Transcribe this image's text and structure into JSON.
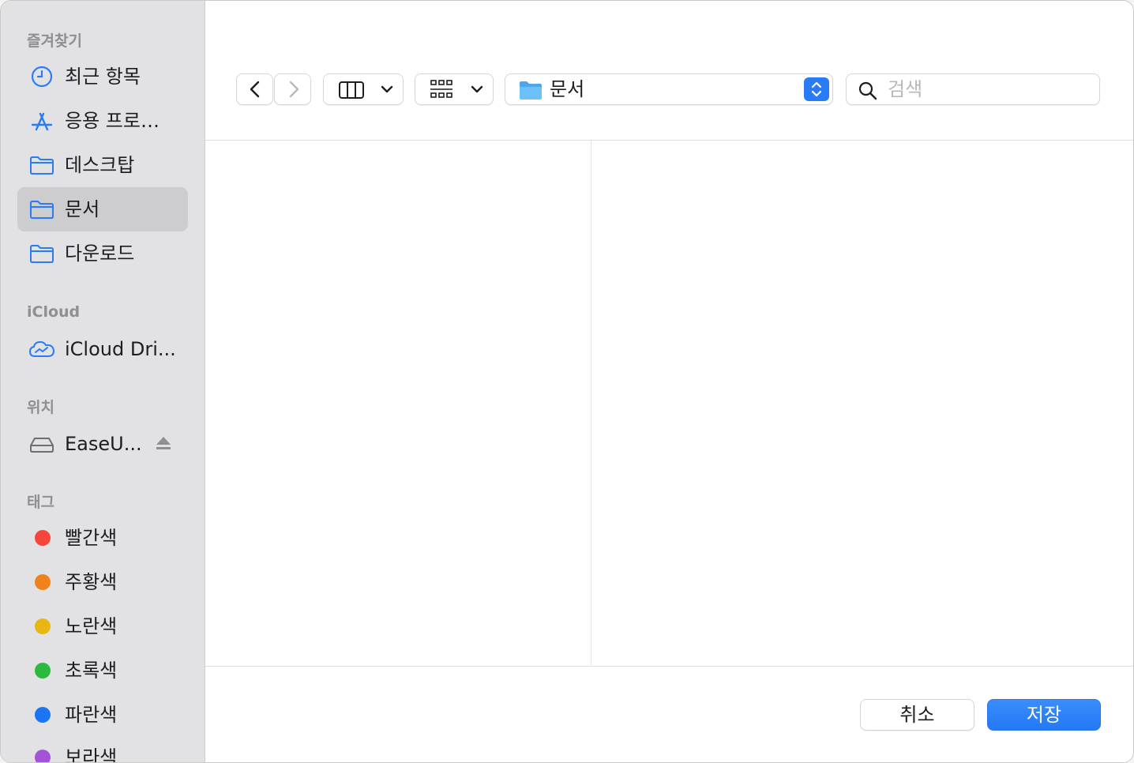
{
  "sidebar": {
    "favorites_header": "즐겨찾기",
    "favorites": [
      {
        "label": "최근 항목",
        "icon": "clock-icon"
      },
      {
        "label": "응용 프로…",
        "icon": "applications-icon"
      },
      {
        "label": "데스크탑",
        "icon": "folder-icon"
      },
      {
        "label": "문서",
        "icon": "folder-icon",
        "selected": true
      },
      {
        "label": "다운로드",
        "icon": "folder-icon"
      }
    ],
    "icloud_header": "iCloud",
    "icloud": [
      {
        "label": "iCloud Dri...",
        "icon": "icloud-drive-icon"
      }
    ],
    "locations_header": "위치",
    "locations": [
      {
        "label": "EaseU...",
        "icon": "drive-icon",
        "ejectable": true
      }
    ],
    "tags_header": "태그",
    "tags": [
      {
        "label": "빨간색",
        "color": "#f6453b"
      },
      {
        "label": "주황색",
        "color": "#f0821e"
      },
      {
        "label": "노란색",
        "color": "#e9b714"
      },
      {
        "label": "초록색",
        "color": "#2bba3f"
      },
      {
        "label": "파란색",
        "color": "#1a74f4"
      },
      {
        "label": "보라색",
        "color": "#a353d6"
      }
    ]
  },
  "toolbar": {
    "current_folder": "문서",
    "search_placeholder": "검색"
  },
  "footer": {
    "cancel_label": "취소",
    "save_label": "저장"
  },
  "colors": {
    "accent": "#2a7cf6",
    "sidebar_bg": "#e2e2e4",
    "sidebar_selected": "#cdcdd0",
    "folder_blue": "#4ea7ee"
  }
}
